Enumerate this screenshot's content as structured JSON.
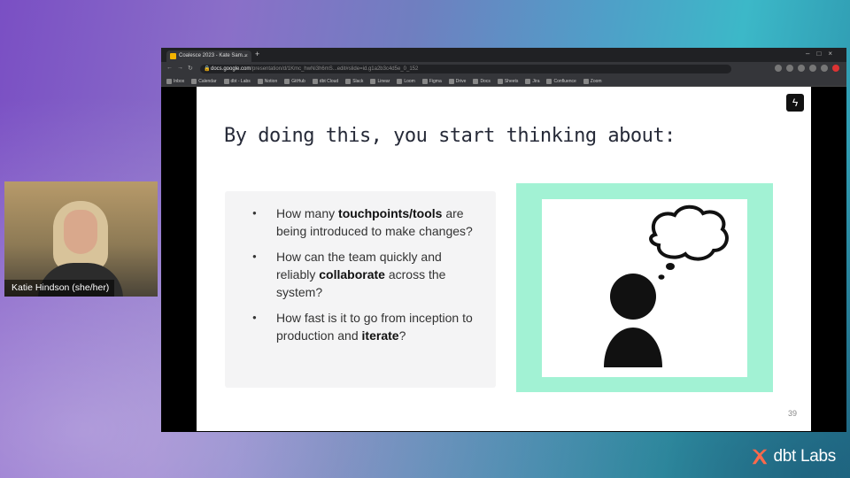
{
  "webcam": {
    "name_label": "Katie Hindson (she/her)"
  },
  "browser": {
    "tab": {
      "title": "Coalesce 2023 - Kate Sam...",
      "close": "×"
    },
    "new_tab": "+",
    "url": {
      "host": "docs.google.com",
      "path": "/presentation/d/1Kmc_hwNi3h6mS...edit#slide=id.g1a2b3c4d5e_0_152"
    },
    "bookmarks": [
      "Inbox",
      "Calendar",
      "dbt - Labs",
      "Notion",
      "GitHub",
      "dbt Cloud",
      "Slack",
      "Linear",
      "Loom",
      "Figma",
      "Drive",
      "Docs",
      "Sheets",
      "Jira",
      "Confluence",
      "Zoom"
    ]
  },
  "slide": {
    "badge_icon": "lightning-icon",
    "title": "By doing this, you start thinking about:",
    "bullets": [
      {
        "pre": "How many ",
        "bold": "touchpoints/tools",
        "post": " are being introduced to make changes?"
      },
      {
        "pre": "How can the team quickly and reliably ",
        "bold": "collaborate",
        "post": " across the system?"
      },
      {
        "pre": "How fast is it to go from inception to production and ",
        "bold": "iterate",
        "post": "?"
      }
    ],
    "illustration": "thinking-person-icon",
    "page_number": "39",
    "colors": {
      "illustration_frame": "#a2f2d4",
      "bullet_panel": "#f4f4f5"
    }
  },
  "brand": {
    "logo_text": "dbt Labs",
    "logo_icon": "dbt-logo-icon",
    "accent": "#ff694b"
  }
}
